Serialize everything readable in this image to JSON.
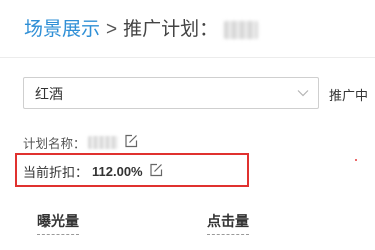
{
  "breadcrumb": {
    "parent": "场景展示",
    "separator": ">",
    "current": "推广计划："
  },
  "scene_select": {
    "value": "红酒"
  },
  "promote_label": "推广中",
  "plan_name": {
    "label": "计划名称："
  },
  "discount": {
    "label": "当前折扣：",
    "value": "112.00%"
  },
  "metrics": [
    {
      "label": "曝光量"
    },
    {
      "label": "点击量"
    }
  ],
  "colors": {
    "link": "#2f8fd6",
    "highlight": "#e0312f"
  },
  "icons": {
    "edit": "edit-icon",
    "dropdown": "chevron-down-icon"
  }
}
